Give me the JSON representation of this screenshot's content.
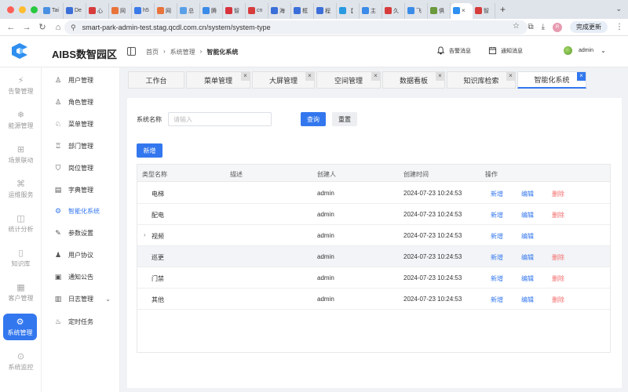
{
  "browser": {
    "tabs": [
      {
        "label": "Tai",
        "color": "#4a90e2"
      },
      {
        "label": "De",
        "color": "#3b6fd8"
      },
      {
        "label": "心",
        "color": "#d63c3c"
      },
      {
        "label": "网",
        "color": "#e8743b"
      },
      {
        "label": "h5",
        "color": "#3b7be8"
      },
      {
        "label": "网",
        "color": "#e8743b"
      },
      {
        "label": "总",
        "color": "#5aa0e8"
      },
      {
        "label": "腾",
        "color": "#3b8be8"
      },
      {
        "label": "智",
        "color": "#d6333c"
      },
      {
        "label": "cn",
        "color": "#d63c3c"
      },
      {
        "label": "海",
        "color": "#3b6fd8"
      },
      {
        "label": "框",
        "color": "#3b6fd8"
      },
      {
        "label": "程",
        "color": "#3b6fd8"
      },
      {
        "label": "【",
        "color": "#2a9ae0"
      },
      {
        "label": "主",
        "color": "#3b8be8"
      },
      {
        "label": "久",
        "color": "#d63c3c"
      },
      {
        "label": "飞",
        "color": "#3b8be8"
      },
      {
        "label": "俱",
        "color": "#6a9a3c"
      }
    ],
    "active_tab_label": "智",
    "url": "smart-park-admin-test.stag.qcdl.com.cn/system/system-type",
    "update_label": "完成更新",
    "profile_initial": "R"
  },
  "header": {
    "title": "AIBS数智园区",
    "breadcrumb": [
      "首页",
      "系统管理",
      "智能化系统"
    ],
    "alarm_label": "告警消息",
    "notice_label": "通知消息",
    "user_name": "admin"
  },
  "rail": {
    "items": [
      {
        "label": "告警管理",
        "icon": "alarm-icon"
      },
      {
        "label": "能源管理",
        "icon": "energy-icon"
      },
      {
        "label": "场景联动",
        "icon": "scene-icon"
      },
      {
        "label": "运维服务",
        "icon": "service-icon"
      },
      {
        "label": "统计分析",
        "icon": "stats-icon"
      },
      {
        "label": "知识库",
        "icon": "book-icon"
      },
      {
        "label": "客户管理",
        "icon": "customer-icon"
      },
      {
        "label": "系统管理",
        "icon": "gear-icon"
      },
      {
        "label": "系统监控",
        "icon": "monitor-icon"
      }
    ],
    "active_index": 7
  },
  "submenu": {
    "items": [
      {
        "label": "用户管理",
        "icon": "users-icon",
        "glyph": "♙"
      },
      {
        "label": "角色管理",
        "icon": "role-icon",
        "glyph": "♙"
      },
      {
        "label": "菜单管理",
        "icon": "menu-icon",
        "glyph": "♘"
      },
      {
        "label": "部门管理",
        "icon": "department-icon",
        "glyph": "♖"
      },
      {
        "label": "岗位管理",
        "icon": "shield-icon",
        "glyph": "⛉"
      },
      {
        "label": "字典管理",
        "icon": "dictionary-icon",
        "glyph": "▤"
      },
      {
        "label": "智能化系统",
        "icon": "gear-icon",
        "glyph": "⚙"
      },
      {
        "label": "参数设置",
        "icon": "edit-icon",
        "glyph": "✎"
      },
      {
        "label": "用户协议",
        "icon": "user-icon",
        "glyph": "♟"
      },
      {
        "label": "通知公告",
        "icon": "notice-icon",
        "glyph": "▣"
      },
      {
        "label": "日志管理",
        "icon": "log-icon",
        "glyph": "▥"
      },
      {
        "label": "定时任务",
        "icon": "task-icon",
        "glyph": "♨"
      }
    ],
    "active_index": 6
  },
  "page_tabs": [
    {
      "label": "工作台",
      "closable": false
    },
    {
      "label": "菜单管理",
      "closable": true
    },
    {
      "label": "大屏管理",
      "closable": true
    },
    {
      "label": "空间管理",
      "closable": true
    },
    {
      "label": "数据看板",
      "closable": true
    },
    {
      "label": "知识库检索",
      "closable": true
    },
    {
      "label": "智能化系统",
      "closable": true
    }
  ],
  "active_page_tab": 6,
  "search": {
    "label": "系统名称",
    "placeholder": "请输入",
    "value": "",
    "query_label": "查询",
    "reset_label": "重置"
  },
  "add_label": "新增",
  "table": {
    "columns": [
      "类型名称",
      "描述",
      "创建人",
      "创建时间",
      "操作"
    ],
    "rows": [
      {
        "name": "电梯",
        "desc": "",
        "creator": "admin",
        "time": "2024-07-23 10:24:53",
        "expandable": false,
        "deletable": true
      },
      {
        "name": "配电",
        "desc": "",
        "creator": "admin",
        "time": "2024-07-23 10:24:53",
        "expandable": false,
        "deletable": true
      },
      {
        "name": "视频",
        "desc": "",
        "creator": "admin",
        "time": "2024-07-23 10:24:53",
        "expandable": true,
        "deletable": false
      },
      {
        "name": "巡更",
        "desc": "",
        "creator": "admin",
        "time": "2024-07-23 10:24:53",
        "expandable": false,
        "deletable": true
      },
      {
        "name": "门禁",
        "desc": "",
        "creator": "admin",
        "time": "2024-07-23 10:24:53",
        "expandable": false,
        "deletable": true
      },
      {
        "name": "其他",
        "desc": "",
        "creator": "admin",
        "time": "2024-07-23 10:24:53",
        "expandable": false,
        "deletable": true
      }
    ],
    "highlight_row": 3,
    "action_add": "新增",
    "action_edit": "编辑",
    "action_delete": "删除"
  }
}
